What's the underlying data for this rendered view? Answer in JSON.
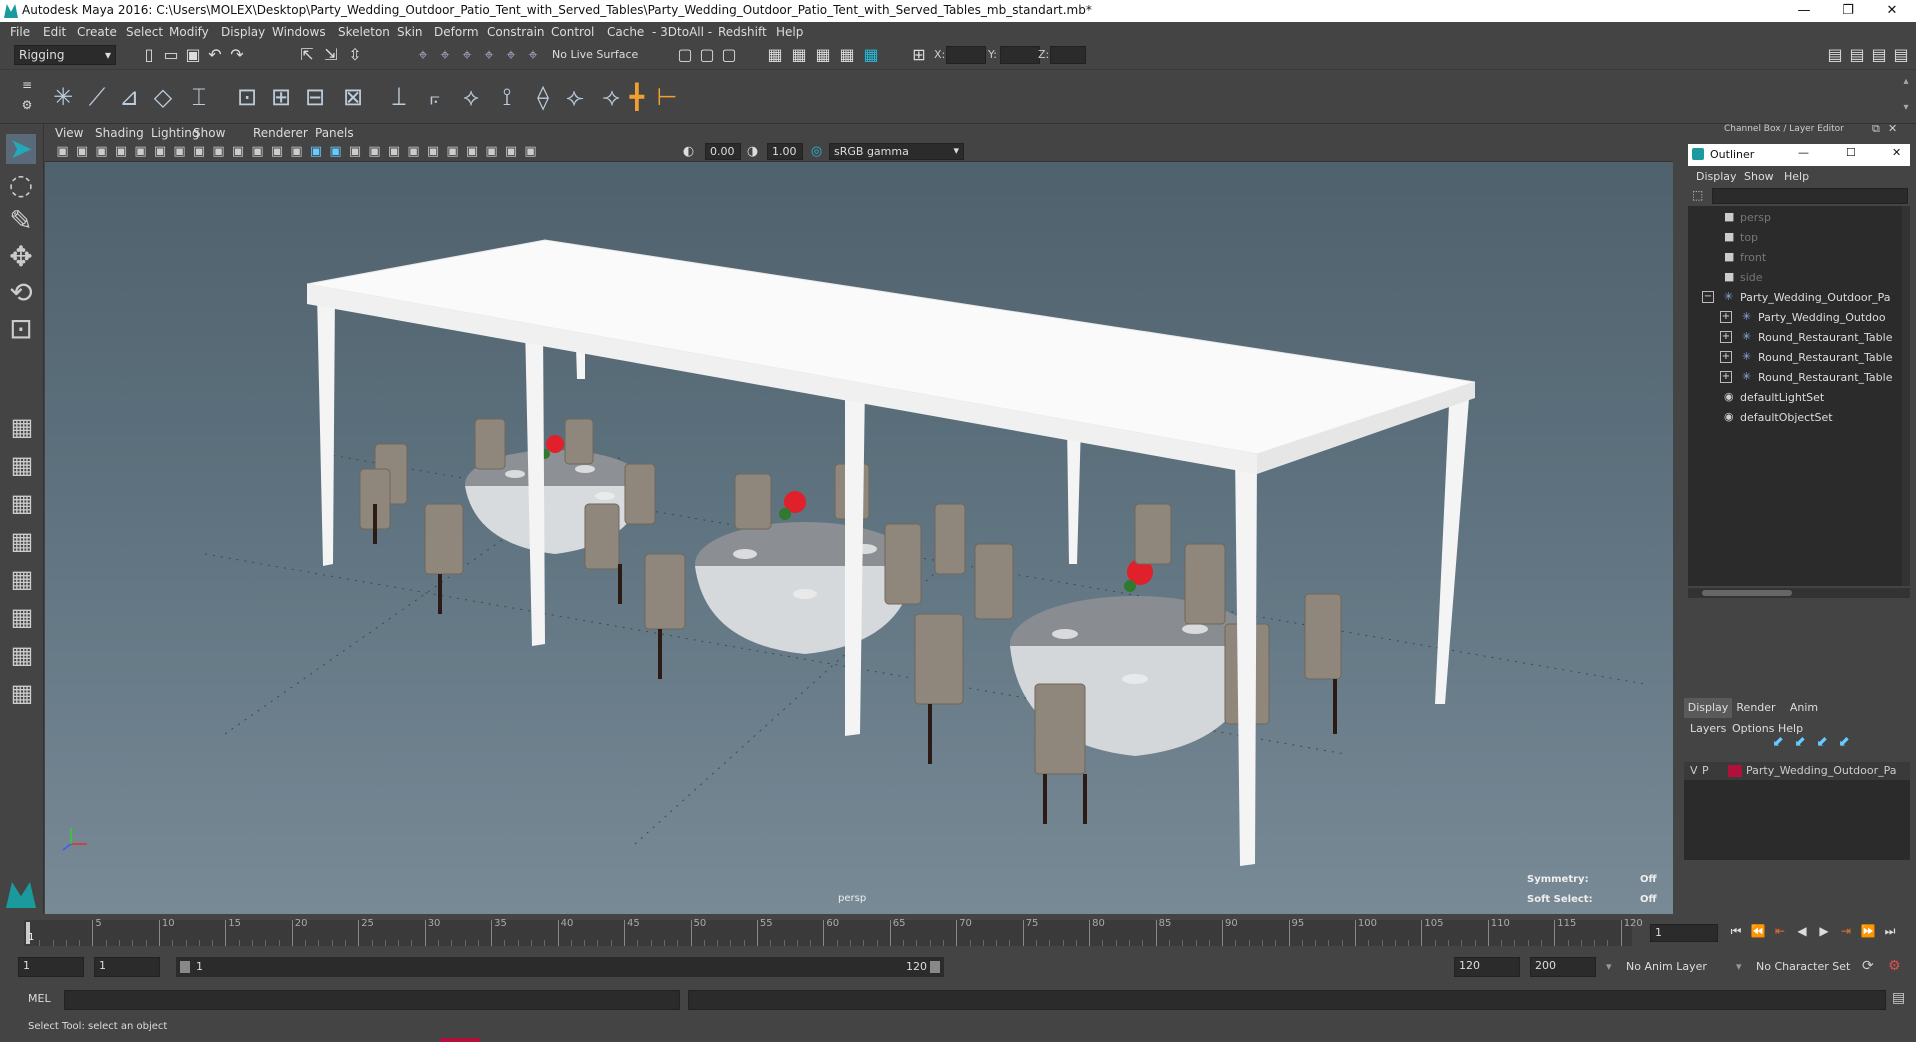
{
  "window": {
    "title": "Autodesk Maya 2016: C:\\Users\\MOLEX\\Desktop\\Party_Wedding_Outdoor_Patio_Tent_with_Served_Tables\\Party_Wedding_Outdoor_Patio_Tent_with_Served_Tables_mb_standart.mb*",
    "minimize": "—",
    "maximize": "❐",
    "close": "✕"
  },
  "menubar": [
    "File",
    "Edit",
    "Create",
    "Select",
    "Modify",
    "Display",
    "Windows",
    "Skeleton",
    "Skin",
    "Deform",
    "Constrain",
    "Control",
    "Cache",
    "- 3DtoAll -",
    "Redshift",
    "Help"
  ],
  "shelf": {
    "mode": "Rigging",
    "live_surface": "No Live Surface",
    "x_label": "X:",
    "y_label": "Y:",
    "z_label": "Z:"
  },
  "viewport": {
    "menus": [
      "View",
      "Shading",
      "Lighting",
      "Show",
      "Renderer",
      "Panels"
    ],
    "exposure": "0.00",
    "gamma": "1.00",
    "colorspace": "sRGB gamma",
    "camera": "persp",
    "symmetry_label": "Symmetry:",
    "symmetry_value": "Off",
    "softselect_label": "Soft Select:",
    "softselect_value": "Off"
  },
  "channelbox": {
    "title": "Channel Box / Layer Editor"
  },
  "outliner": {
    "title": "Outliner",
    "menus": [
      "Display",
      "Show",
      "Help"
    ],
    "items": [
      {
        "label": "persp",
        "type": "camera",
        "indent": 0,
        "dim": true
      },
      {
        "label": "top",
        "type": "camera",
        "indent": 0,
        "dim": true
      },
      {
        "label": "front",
        "type": "camera",
        "indent": 0,
        "dim": true
      },
      {
        "label": "side",
        "type": "camera",
        "indent": 0,
        "dim": true
      },
      {
        "label": "Party_Wedding_Outdoor_Pa",
        "type": "group",
        "indent": 0,
        "expander": "−"
      },
      {
        "label": "Party_Wedding_Outdoo",
        "type": "group",
        "indent": 1,
        "expander": "+"
      },
      {
        "label": "Round_Restaurant_Table",
        "type": "group",
        "indent": 1,
        "expander": "+"
      },
      {
        "label": "Round_Restaurant_Table",
        "type": "group",
        "indent": 1,
        "expander": "+"
      },
      {
        "label": "Round_Restaurant_Table",
        "type": "group",
        "indent": 1,
        "expander": "+"
      },
      {
        "label": "defaultLightSet",
        "type": "set",
        "indent": 0
      },
      {
        "label": "defaultObjectSet",
        "type": "set",
        "indent": 0
      }
    ]
  },
  "layers": {
    "tabs": [
      "Display",
      "Render",
      "Anim"
    ],
    "menus": [
      "Layers",
      "Options",
      "Help"
    ],
    "row": {
      "v": "V",
      "p": "P",
      "name": "Party_Wedding_Outdoor_Pa",
      "color": "#b0113a"
    }
  },
  "timeline": {
    "ticks": [
      5,
      10,
      15,
      20,
      25,
      30,
      35,
      40,
      45,
      50,
      55,
      60,
      65,
      70,
      75,
      80,
      85,
      90,
      95,
      100,
      105,
      110,
      115,
      120
    ],
    "current": "1",
    "frame_field": "1"
  },
  "range": {
    "start": "1",
    "start2": "1",
    "slider_start": "1",
    "slider_end": "120",
    "end": "120",
    "end2": "200",
    "anim_layer": "No Anim Layer",
    "char_set": "No Character Set"
  },
  "cmd": {
    "label": "MEL"
  },
  "status": {
    "text": "Select Tool: select an object"
  }
}
